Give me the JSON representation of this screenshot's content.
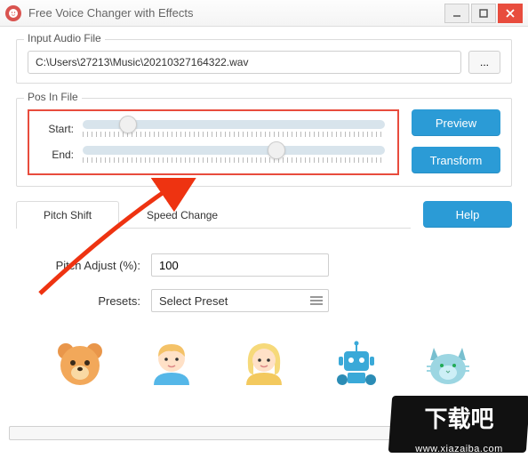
{
  "window": {
    "title": "Free Voice Changer with Effects"
  },
  "inputFile": {
    "legend": "Input Audio File",
    "path": "C:\\Users\\27213\\Music\\20210327164322.wav",
    "browse_label": "..."
  },
  "posInFile": {
    "legend": "Pos In File",
    "start_label": "Start:",
    "end_label": "End:",
    "start_value_pct": 15,
    "end_value_pct": 64
  },
  "buttons": {
    "preview": "Preview",
    "transform": "Transform",
    "help": "Help"
  },
  "tabs": {
    "pitch": "Pitch Shift",
    "speed": "Speed Change",
    "active": "pitch"
  },
  "pitchShift": {
    "adjust_label": "Pitch Adjust (%):",
    "adjust_value": "100",
    "presets_label": "Presets:",
    "presets_placeholder": "Select Preset"
  },
  "presets": {
    "items": [
      "bear",
      "boy",
      "girl",
      "robot",
      "cat"
    ]
  },
  "watermark": {
    "text": "下载吧",
    "url": "www.xiazaiba.com"
  }
}
